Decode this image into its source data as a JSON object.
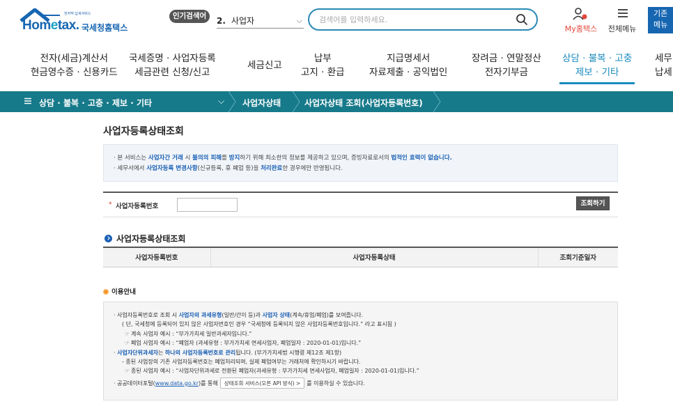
{
  "header": {
    "logo_slogan": "전자적 납세서비스",
    "logo_brand_a": "Hom",
    "logo_brand_e": "e",
    "logo_brand_b": "tax.",
    "logo_kname": "국세청홈택스",
    "popular_badge": "인기검색어",
    "popular_num": "2.",
    "popular_term": "사업자",
    "search_placeholder": "검색어를 입력하세요.",
    "my_hometax_a": "My",
    "my_hometax_b": "홈택스",
    "allmenu_label": "전체메뉴",
    "basic_menu_1": "기존",
    "basic_menu_2": "메뉴"
  },
  "gnb": [
    {
      "l1": "전자(세금)계산서",
      "l2": "현금영수증 · 신용카드"
    },
    {
      "l1": "국세증명 · 사업자등록",
      "l2": "세금관련 신청/신고"
    },
    {
      "l1": "세금신고",
      "l2": ""
    },
    {
      "l1": "납부",
      "l2": "고지 · 환급"
    },
    {
      "l1": "지급명세서",
      "l2": "자료제출 · 공익법인"
    },
    {
      "l1": "장려금 · 연말정산",
      "l2": "전자기부금"
    },
    {
      "l1": "상담 · 불복 · 고충",
      "l2": "제보 · 기타"
    },
    {
      "l1": "세무",
      "l2": "납세"
    }
  ],
  "breadcrumb": {
    "c1": "상담 · 불복 · 고충 · 제보 · 기타",
    "c2": "사업자상태",
    "c3": "사업자상태 조회(사업자등록번호)"
  },
  "page": {
    "title": "사업자등록상태조회",
    "notice": {
      "l1_a": "· 본 서비스는 ",
      "l1_b": "사업자간 거래",
      "l1_c": " 시 ",
      "l1_d": "불의의 피해",
      "l1_e": "를 ",
      "l1_f": "방지",
      "l1_g": "하기 위해 최소한의 정보를 제공하고 있으며, 증빙자료로서의 ",
      "l1_h": "법적인 효력이 없습니다.",
      "l2_a": "· 세무서에서 ",
      "l2_b": "사업자등록 변경사항",
      "l2_c": "(신규등록, 휴 폐업 등)을 ",
      "l2_d": "처리완료",
      "l2_e": "한 경우에만 반영됩니다."
    },
    "query": {
      "required_mark": "*",
      "label": "사업자등록번호",
      "input_value": "",
      "button": "조회하기"
    },
    "result": {
      "title": "사업자등록상태조회",
      "columns": [
        "사업자등록번호",
        "사업자등록상태",
        "조회기준일자"
      ]
    },
    "guide": {
      "title": "이용안내",
      "g1_a": "· 사업자등록번호로 조회 시 ",
      "g1_b": "사업자의 과세유형",
      "g1_c": "(일반/간이 등)과 ",
      "g1_d": "사업자 상태",
      "g1_e": "(계속/휴업/폐업)를 보여줍니다.",
      "g2": "( 단, 국세청에 등록되어 있지 않은 사업자번호인 경우 “국세청에 등록되지 않은 사업자등록번호입니다.” 라고 표시됨 )",
      "g3_mark": "☞",
      "g3": "계속 사업자 예시 : “부가가치세 일반과세자입니다.”",
      "g4_mark": "☞",
      "g4": "폐업 사업자 예시 : “폐업자 (과세유형 : 부가가치세 면세사업자, 폐업일자 : 2020-01-01)입니다.”",
      "g5_a": "· ",
      "g5_b": "사업자단위과세자",
      "g5_c": "는 ",
      "g5_d": "하나의 사업자등록번호로 관리",
      "g5_e": "됩니다. (부가가치세법 시행령 제12조 제1항)",
      "g6": "- 종된 사업장의 기존 사업자등록번호는 폐업처리되며, 실제 폐업여부는 거래처에 확인하시기 바랍니다.",
      "g7_mark": "☞",
      "g7": "종된 사업자 예시 : “사업자단위과세로 전환된 폐업자(과세유형 : 부가가치세 면세사업자, 폐업일자 : 2020-01-01)입니다.”",
      "g8_a": "· 공공데이터포털(",
      "g8_link": "www.data.go.kr",
      "g8_b": ")를 통해",
      "g8_btn": "상태조회 서비스(오픈 API 방식) >",
      "g8_c": "를 이용하실 수 있습니다."
    }
  },
  "colors": {
    "primary_blue": "#1766b2",
    "teal_bar": "#167a8a",
    "active_gnb": "#1a8bbd",
    "accent_red": "#e4463a",
    "emphasis_blue": "#1a5fb4",
    "guide_orange": "#f08a1c"
  },
  "icons": [
    "hometax-logo-roof",
    "chevron-down-icon",
    "search-icon",
    "my-hometax-icon",
    "hamburger-menu-icon",
    "breadcrumb-separator-icon",
    "circle-arrow-icon",
    "orange-bullet-icon"
  ]
}
